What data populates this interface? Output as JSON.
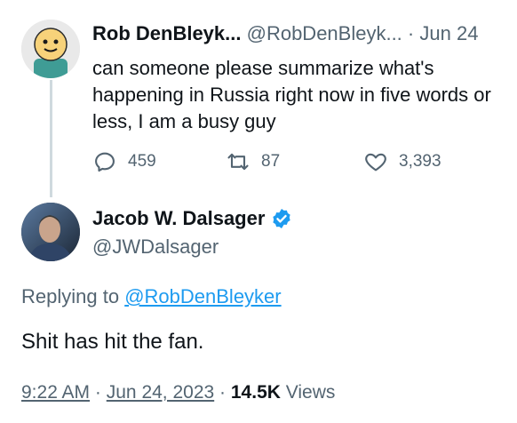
{
  "parent_tweet": {
    "display_name": "Rob DenBleyk...",
    "handle": "@RobDenBleyk...",
    "separator": "·",
    "date": "Jun 24",
    "text": "can someone please summarize what's happening in Russia right now in five words or less, I am a busy guy",
    "avatar_icon": "cartoon-face-avatar",
    "actions": {
      "reply_count": "459",
      "retweet_count": "87",
      "like_count": "3,393"
    }
  },
  "reply_tweet": {
    "display_name": "Jacob W. Dalsager",
    "handle": "@JWDalsager",
    "verified_icon": "verified-badge-icon",
    "replying_prefix": "Replying to",
    "replying_handle": "@RobDenBleyker",
    "text": "Shit has hit the fan.",
    "time": "9:22 AM",
    "dot": "·",
    "date": "Jun 24, 2023",
    "views_count": "14.5K",
    "views_label": "Views"
  },
  "colors": {
    "text": "#0f1419",
    "muted": "#536471",
    "link": "#1d9bf0",
    "thread_line": "#cfd9de"
  }
}
